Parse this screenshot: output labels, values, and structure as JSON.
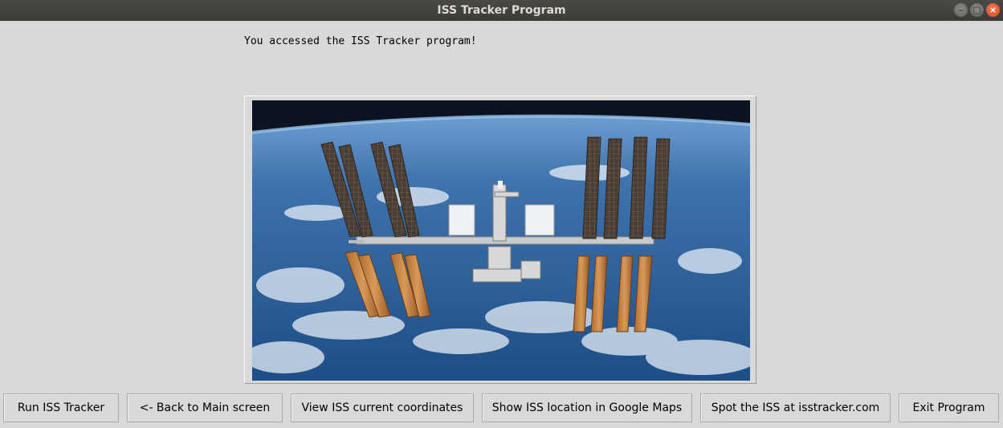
{
  "window": {
    "title": "ISS Tracker Program"
  },
  "message": "You accessed the ISS Tracker program!",
  "image": {
    "subject": "International Space Station above Earth"
  },
  "buttons": {
    "run": "Run ISS Tracker",
    "back": "<- Back to Main screen",
    "coords": "View ISS current coordinates",
    "maps": "Show ISS location in Google Maps",
    "spot": "Spot the ISS at isstracker.com",
    "exit": "Exit Program"
  }
}
